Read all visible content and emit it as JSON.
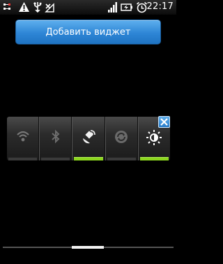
{
  "status_bar": {
    "clock": "22:17",
    "icons": [
      "usb-debug-icon",
      "warning-icon",
      "usb-icon",
      "no-signal-icon",
      "signal-bars-icon",
      "battery-icon",
      "alarm-icon"
    ]
  },
  "add_widget_button": {
    "label": "Добавить виджет"
  },
  "power_widget": {
    "toggles": [
      {
        "icon": "wifi-icon",
        "on": false
      },
      {
        "icon": "bluetooth-icon",
        "on": false
      },
      {
        "icon": "gps-icon",
        "on": true
      },
      {
        "icon": "sync-icon",
        "on": false
      },
      {
        "icon": "brightness-icon",
        "on": true
      }
    ],
    "colors": {
      "on": "#8cd61e",
      "off": "#3a3a3a",
      "button": "#2e86d6"
    }
  }
}
